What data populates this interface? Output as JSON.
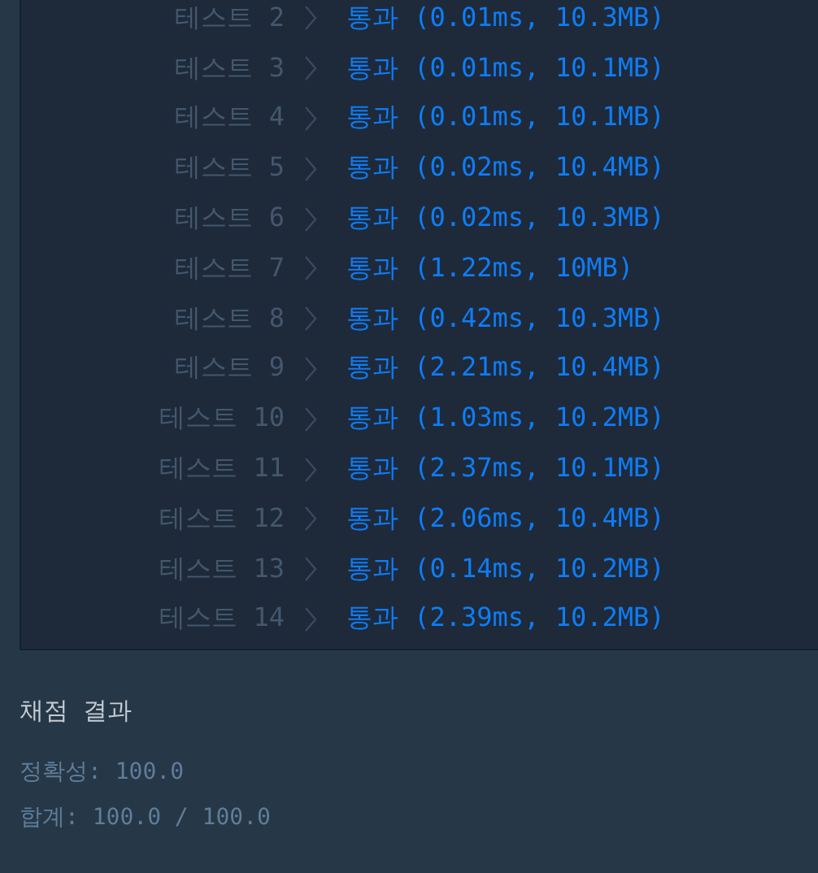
{
  "tests": [
    {
      "label": "테스트 2",
      "result": "통과 (0.01ms, 10.3MB)"
    },
    {
      "label": "테스트 3",
      "result": "통과 (0.01ms, 10.1MB)"
    },
    {
      "label": "테스트 4",
      "result": "통과 (0.01ms, 10.1MB)"
    },
    {
      "label": "테스트 5",
      "result": "통과 (0.02ms, 10.4MB)"
    },
    {
      "label": "테스트 6",
      "result": "통과 (0.02ms, 10.3MB)"
    },
    {
      "label": "테스트 7",
      "result": "통과 (1.22ms, 10MB)"
    },
    {
      "label": "테스트 8",
      "result": "통과 (0.42ms, 10.3MB)"
    },
    {
      "label": "테스트 9",
      "result": "통과 (2.21ms, 10.4MB)"
    },
    {
      "label": "테스트 10",
      "result": "통과 (1.03ms, 10.2MB)"
    },
    {
      "label": "테스트 11",
      "result": "통과 (2.37ms, 10.1MB)"
    },
    {
      "label": "테스트 12",
      "result": "통과 (2.06ms, 10.4MB)"
    },
    {
      "label": "테스트 13",
      "result": "통과 (0.14ms, 10.2MB)"
    },
    {
      "label": "테스트 14",
      "result": "통과 (2.39ms, 10.2MB)"
    }
  ],
  "summary": {
    "title": "채점 결과",
    "lines": [
      "정확성: 100.0",
      "합계: 100.0 / 100.0"
    ]
  }
}
